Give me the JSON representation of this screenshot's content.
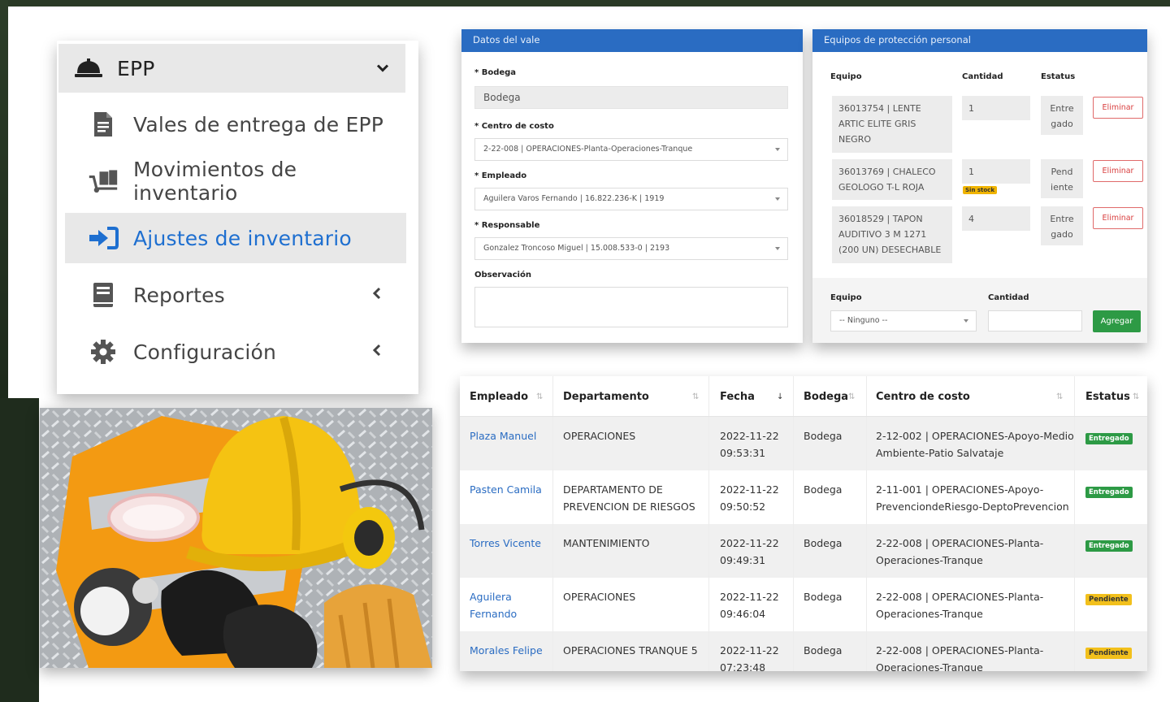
{
  "sidebar": {
    "header": {
      "label": "EPP",
      "icon": "hard-hat-icon"
    },
    "items": [
      {
        "label": "Vales de entrega de EPP",
        "icon": "document-icon"
      },
      {
        "label": "Movimientos de inventario",
        "icon": "dolly-icon"
      },
      {
        "label": "Ajustes de inventario",
        "icon": "sign-in-arrow-icon",
        "active": true
      },
      {
        "label": "Reportes",
        "icon": "book-icon"
      },
      {
        "label": "Configuración",
        "icon": "gear-icon"
      }
    ]
  },
  "voucher": {
    "title": "Datos del vale",
    "bodega_label": "* Bodega",
    "bodega_value": "Bodega",
    "centro_label": "* Centro de costo",
    "centro_value": "2-22-008 | OPERACIONES-Planta-Operaciones-Tranque",
    "empleado_label": "* Empleado",
    "empleado_value": "Aguilera Varos Fernando | 16.822.236-K | 1919",
    "responsable_label": "* Responsable",
    "responsable_value": "Gonzalez Troncoso Miguel | 15.008.533-0 | 2193",
    "observacion_label": "Observación"
  },
  "ppe": {
    "title": "Equipos de protección personal",
    "col_equipo": "Equipo",
    "col_cantidad": "Cantidad",
    "col_estatus": "Estatus",
    "items": [
      {
        "line1": "36013754 | LENTE",
        "line2": "ARTIC ELITE GRIS",
        "line3": "NEGRO",
        "qty": "1",
        "status1": "Entre",
        "status2": "gado",
        "delete": "Eliminar"
      },
      {
        "line1": "36013769 | CHALECO",
        "line2": "GEOLOGO T-L ROJA",
        "line3": "",
        "qty": "1",
        "badge": "Sin stock",
        "status1": "Pend",
        "status2": "iente",
        "delete": "Eliminar"
      },
      {
        "line1": "36018529 | TAPON",
        "line2": "AUDITIVO 3 M 1271",
        "line3": "(200 UN) DESECHABLE",
        "qty": "4",
        "status1": "Entre",
        "status2": "gado",
        "delete": "Eliminar"
      }
    ],
    "add_equipo_label": "Equipo",
    "add_cantidad_label": "Cantidad",
    "add_select_value": "-- Ninguno --",
    "add_button": "Agregar"
  },
  "table": {
    "headers": [
      "Empleado",
      "Departamento",
      "Fecha",
      "Bodega",
      "Centro de costo",
      "Estatus"
    ],
    "rows": [
      {
        "empleado": "Plaza Manuel",
        "empleado2": "",
        "depto": "OPERACIONES",
        "depto2": "",
        "fecha": "2022-11-22",
        "hora": "09:53:31",
        "bodega": "Bodega",
        "centro": "2-12-002 | OPERACIONES-Apoyo-Medio",
        "centro2": "Ambiente-Patio Salvataje",
        "estatus": "Entregado"
      },
      {
        "empleado": "Pasten Camila",
        "empleado2": "",
        "depto": "DEPARTAMENTO DE",
        "depto2": "PREVENCION DE RIESGOS",
        "fecha": "2022-11-22",
        "hora": "09:50:52",
        "bodega": "Bodega",
        "centro": "2-11-001 | OPERACIONES-Apoyo-",
        "centro2": "PrevenciondeRiesgo-DeptoPrevencion",
        "estatus": "Entregado"
      },
      {
        "empleado": "Torres Vicente",
        "empleado2": "",
        "depto": "MANTENIMIENTO",
        "depto2": "",
        "fecha": "2022-11-22",
        "hora": "09:49:31",
        "bodega": "Bodega",
        "centro": "2-22-008 | OPERACIONES-Planta-",
        "centro2": "Operaciones-Tranque",
        "estatus": "Entregado"
      },
      {
        "empleado": "Aguilera",
        "empleado2": "Fernando",
        "depto": "OPERACIONES",
        "depto2": "",
        "fecha": "2022-11-22",
        "hora": "09:46:04",
        "bodega": "Bodega",
        "centro": "2-22-008 | OPERACIONES-Planta-",
        "centro2": "Operaciones-Tranque",
        "estatus": "Pendiente"
      },
      {
        "empleado": "Morales Felipe",
        "empleado2": "",
        "depto": "OPERACIONES TRANQUE 5",
        "depto2": "",
        "fecha": "2022-11-22",
        "hora": "07:23:48",
        "bodega": "Bodega",
        "centro": "2-22-008 | OPERACIONES-Planta-",
        "centro2": "Operaciones-Tranque",
        "estatus": "Pendiente"
      }
    ]
  },
  "colors": {
    "accent": "#2a6cc2",
    "ok": "#2d9a45",
    "pending": "#f2c01c",
    "danger": "#d94040"
  }
}
